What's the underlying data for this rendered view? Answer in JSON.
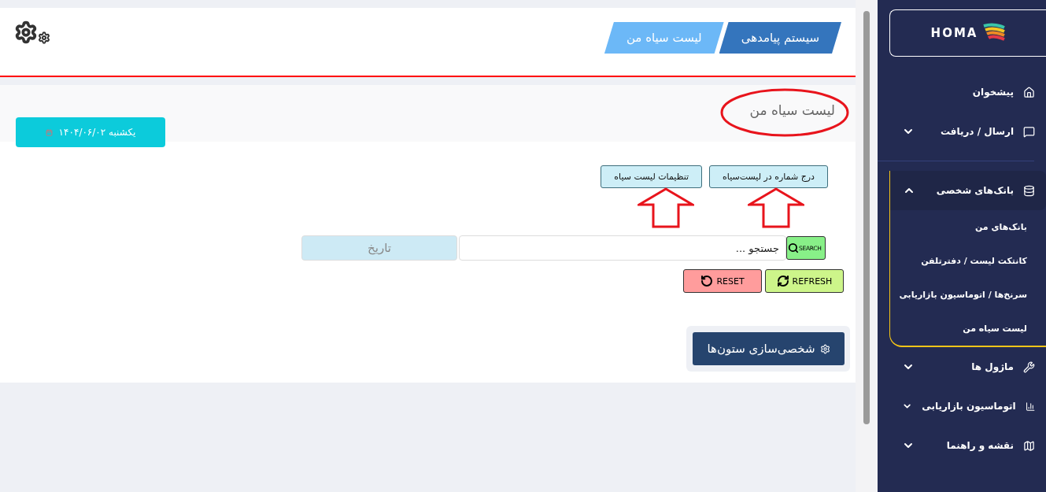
{
  "header": {
    "breadcrumbs": [
      {
        "label": "سیستم پیامدهی",
        "kind": "root"
      },
      {
        "label": "لیست سیاه من",
        "kind": "current"
      }
    ]
  },
  "page": {
    "title": "لیست سیاه من",
    "date": "یکشنبه ۱۴۰۴/۰۶/۰۲"
  },
  "actions": [
    "درج شماره در لیست‌سیاه",
    "تنظیمات لیست سیاه"
  ],
  "search": {
    "placeholder": "جستجو ...",
    "button": "SEARCH",
    "date_placeholder": "تاریخ"
  },
  "tools": [
    {
      "label": "REFRESH",
      "kind": "refresh"
    },
    {
      "label": "RESET",
      "kind": "reset"
    }
  ],
  "customize": "شخصی‌سازی ستون‌ها",
  "sidebar": {
    "logo": "HOMA",
    "items": [
      {
        "label": "پیشخوان"
      },
      {
        "label": "ارسال / دریافت",
        "expanded": false
      },
      {
        "label": "بانک‌های شخصی",
        "expanded": true,
        "children": [
          {
            "label": "بانک‌های من"
          },
          {
            "label": "کانتکت لیست / دفترتلفن"
          },
          {
            "label": "سرنخ‌ها / اتوماسیون بازاریابی"
          },
          {
            "label": "لیست سیاه من"
          }
        ]
      },
      {
        "label": "ماژول ها",
        "expanded": false
      },
      {
        "label": "اتوماسیون بازاریابی",
        "expanded": false
      },
      {
        "label": "نقشه و راهنما",
        "expanded": false
      }
    ]
  }
}
